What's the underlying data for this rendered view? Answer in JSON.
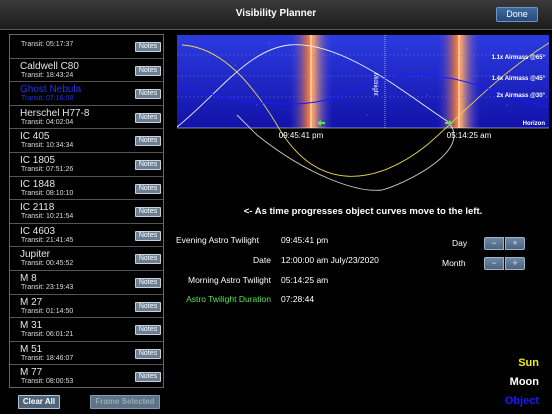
{
  "nav": {
    "title": "Visibility Planner",
    "done_label": "Done"
  },
  "list": {
    "notes_label": "Notes",
    "items": [
      {
        "name": "",
        "transit": "Transit: 05:17:37"
      },
      {
        "name": "Caldwell C80",
        "transit": "Transit: 18:43:24"
      },
      {
        "name": "Ghost Nebula",
        "transit": "Transit: 07:16:08"
      },
      {
        "name": "Herschel H77-8",
        "transit": "Transit: 04:02:04"
      },
      {
        "name": "IC 405",
        "transit": "Transit: 10:34:34"
      },
      {
        "name": "IC 1805",
        "transit": "Transit: 07:51:26"
      },
      {
        "name": "IC 1848",
        "transit": "Transit: 08:10:10"
      },
      {
        "name": "IC 2118",
        "transit": "Transit: 10:21:54"
      },
      {
        "name": "IC 4603",
        "transit": "Transit: 21:41:45"
      },
      {
        "name": "Jupiter",
        "transit": "Transit: 00:45:52"
      },
      {
        "name": "M 8",
        "transit": "Transit: 23:19:43"
      },
      {
        "name": "M 27",
        "transit": "Transit: 01:14:50"
      },
      {
        "name": "M 31",
        "transit": "Transit: 06:01:21"
      },
      {
        "name": "M 51",
        "transit": "Transit: 18:46:07"
      },
      {
        "name": "M 77",
        "transit": "Transit: 08:00:53"
      }
    ]
  },
  "buttons": {
    "clear_all": "Clear All",
    "frame_selected": "Frame Selected"
  },
  "chart": {
    "midnight_label": "Midnight",
    "horizon_label": "Horizon",
    "airmass_labels": [
      "1.1x Airmass @65°",
      "1.4x Airmass @45°",
      "2x Airmass @30°"
    ],
    "evening_time": "09:45:41 pm",
    "morning_time": "05:14:25 am",
    "caption": "<- As time progresses object curves move to the left."
  },
  "info": {
    "evening_label": "Evening Astro Twilight",
    "evening_value": "09:45:41 pm",
    "date_label": "Date",
    "date_value": "12:00:00 am July/23/2020",
    "morning_label": "Morning  Astro Twilight",
    "morning_value": "05:14:25 am",
    "duration_label": "Astro Twilight Duration",
    "duration_value": "07:28:44"
  },
  "steppers": {
    "day_label": "Day",
    "month_label": "Month",
    "minus": "−",
    "plus": "+"
  },
  "legend": {
    "sun": "Sun",
    "moon": "Moon",
    "object": "Object"
  },
  "colors": {
    "sun": "#f2f200",
    "moon": "#ffffff",
    "object": "#1a1aff",
    "twilight_text": "#52e852",
    "chart_sky": "#1420c8"
  }
}
